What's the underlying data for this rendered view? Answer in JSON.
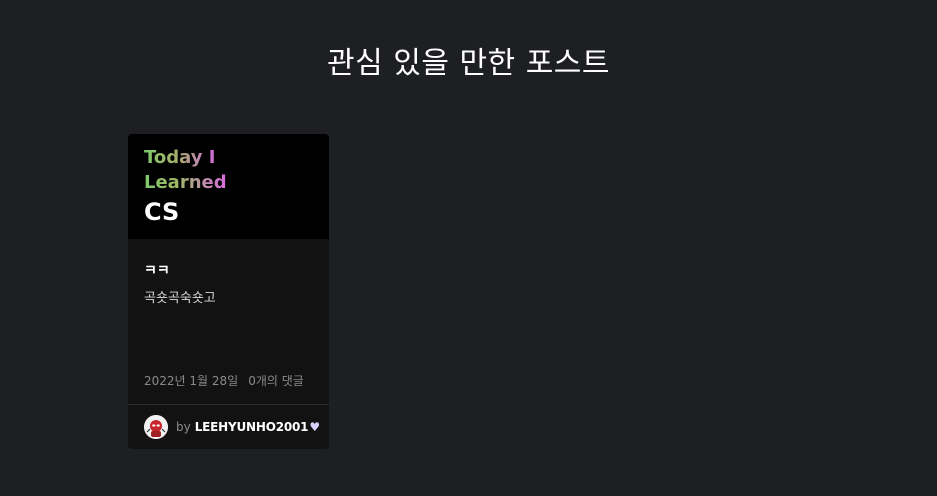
{
  "section": {
    "title": "관심 있을 만한 포스트"
  },
  "card": {
    "thumbnail": {
      "line1": "Today I",
      "line2": "Learned",
      "line3": "CS"
    },
    "title": "ㅋㅋ",
    "excerpt": "곡숏곡숙숏고",
    "date": "2022년 1월 28일",
    "comments": "0개의 댓글",
    "by_label": "by",
    "author": "LEEHYUNHO2001",
    "heart": "♥"
  },
  "colors": {
    "background": "#1e1f22",
    "card": "#121212",
    "gradient_start": "#7dc96a",
    "gradient_end": "#d06ad9"
  },
  "icons": {
    "avatar": "user-avatar"
  }
}
